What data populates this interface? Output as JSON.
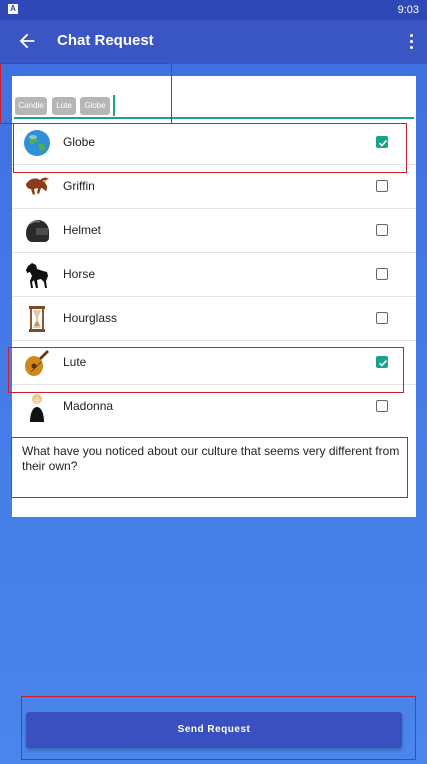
{
  "status_bar": {
    "time": "9:03",
    "notification_icon": "A"
  },
  "app_bar": {
    "title": "Chat Request",
    "back_icon": "arrow-back-icon",
    "menu_icon": "more-vert-icon"
  },
  "chips": [
    "Candle",
    "Lute",
    "Globe"
  ],
  "items": [
    {
      "label": "Globe",
      "icon": "globe-icon",
      "checked": true
    },
    {
      "label": "Griffin",
      "icon": "griffin-icon",
      "checked": false
    },
    {
      "label": "Helmet",
      "icon": "helmet-icon",
      "checked": false
    },
    {
      "label": "Horse",
      "icon": "horse-icon",
      "checked": false
    },
    {
      "label": "Hourglass",
      "icon": "hourglass-icon",
      "checked": false
    },
    {
      "label": "Lute",
      "icon": "lute-icon",
      "checked": true
    },
    {
      "label": "Madonna",
      "icon": "madonna-icon",
      "checked": false
    }
  ],
  "message": {
    "text": "What have you noticed about our culture that seems very different from  their own?"
  },
  "send_button": {
    "label": "Send Request"
  },
  "colors": {
    "primary": "#3a56c4",
    "accent": "#19a38a",
    "highlight": "#cc1f2a"
  }
}
